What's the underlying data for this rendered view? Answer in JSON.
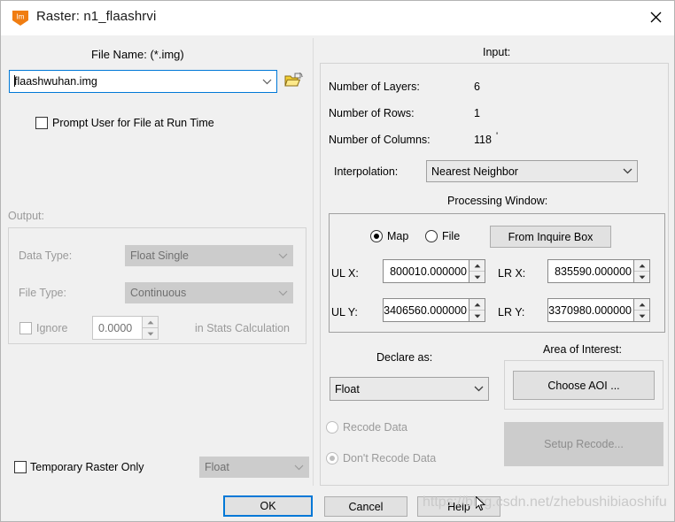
{
  "window": {
    "title": "Raster:  n1_flaashrvi",
    "icon": "erdas-imagine-logo",
    "icon_label": "Im",
    "close_label": "✕"
  },
  "left": {
    "file_name_label": "File Name: (*.img)",
    "file_name_value": "flaashwuhan.img",
    "browse_icon": "open-folder-icon",
    "prompt_user_label": "Prompt User for File at Run Time",
    "prompt_user_checked": false,
    "output_label": "Output:",
    "data_type_label": "Data Type:",
    "data_type_value": "Float Single",
    "file_type_label": "File Type:",
    "file_type_value": "Continuous",
    "ignore_label": "Ignore",
    "ignore_checked": false,
    "ignore_value": "0.0000",
    "stats_label": "in Stats Calculation",
    "temporary_raster_label": "Temporary Raster Only",
    "temporary_raster_checked": false,
    "temp_type_value": "Float"
  },
  "right": {
    "input_label": "Input:",
    "info_rows": [
      {
        "label": "Number of Layers:",
        "value": "6"
      },
      {
        "label": "Number of Rows:",
        "value": "1"
      },
      {
        "label": "Number of Columns:",
        "value": "118"
      }
    ],
    "interpolation_label": "Interpolation:",
    "interpolation_value": "Nearest Neighbor",
    "processing_window_label": "Processing Window:",
    "map_label": "Map",
    "file_label": "File",
    "coord_mode": "Map",
    "from_inquire_box_label": "From Inquire Box",
    "coords": [
      {
        "label": "UL X:",
        "value": "800010.000000"
      },
      {
        "label": "LR X:",
        "value": "835590.000000"
      },
      {
        "label": "UL Y:",
        "value": "3406560.000000"
      },
      {
        "label": "LR Y:",
        "value": "3370980.000000"
      }
    ],
    "declare_as_label": "Declare as:",
    "declare_as_value": "Float",
    "recode_data_label": "Recode Data",
    "dont_recode_data_label": "Don't Recode Data",
    "recode_mode": "Don't Recode Data",
    "area_of_interest_label": "Area of Interest:",
    "choose_aoi_label": "Choose AOI ...",
    "setup_recode_label": "Setup Recode..."
  },
  "footer": {
    "ok_label": "OK",
    "cancel_label": "Cancel",
    "help_label": "Help"
  },
  "watermark": {
    "text": "https://blog.csdn.net/zhebushibiaoshifu"
  }
}
